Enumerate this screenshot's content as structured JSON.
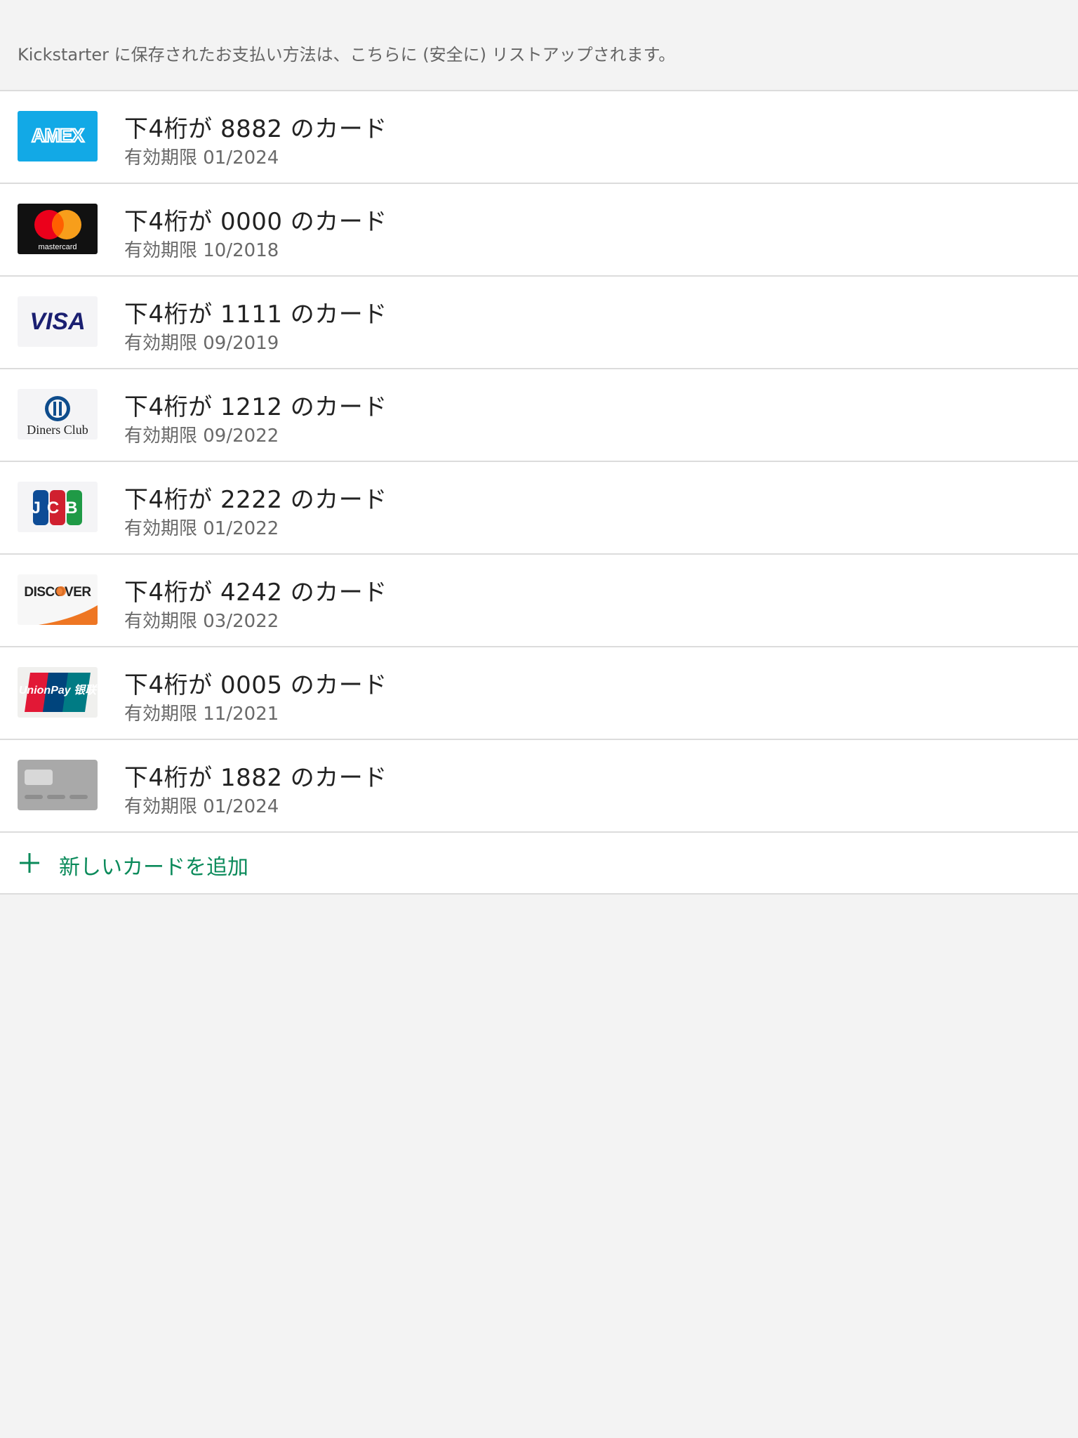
{
  "header": {
    "description": "Kickstarter に保存されたお支払い方法は、こちらに (安全に) リストアップされます。"
  },
  "cards": [
    {
      "brand": "amex-logo",
      "logo_text": "AMEX",
      "title": "下4桁が 8882 のカード",
      "expiry": "有効期限 01/2024"
    },
    {
      "brand": "mastercard-logo",
      "logo_text": "mastercard",
      "title": "下4桁が 0000 のカード",
      "expiry": "有効期限 10/2018"
    },
    {
      "brand": "visa-logo",
      "logo_text": "VISA",
      "title": "下4桁が 1111 のカード",
      "expiry": "有効期限 09/2019"
    },
    {
      "brand": "diners-club-logo",
      "logo_text": "Diners Club",
      "title": "下4桁が 1212 のカード",
      "expiry": "有効期限 09/2022"
    },
    {
      "brand": "jcb-logo",
      "logo_text": "JCB",
      "title": "下4桁が 2222 のカード",
      "expiry": "有効期限 01/2022"
    },
    {
      "brand": "discover-logo",
      "logo_text": "DISCOVER",
      "title": "下4桁が 4242 のカード",
      "expiry": "有効期限 03/2022"
    },
    {
      "brand": "unionpay-logo",
      "logo_text": "UnionPay 银联",
      "title": "下4桁が 0005 のカード",
      "expiry": "有効期限 11/2021"
    },
    {
      "brand": "generic-card-icon",
      "logo_text": "",
      "title": "下4桁が 1882 のカード",
      "expiry": "有効期限 01/2024"
    }
  ],
  "add_card": {
    "icon": "plus-icon",
    "label": "新しいカードを追加"
  },
  "colors": {
    "background": "#f3f3f3",
    "accent_green": "#0a8a5a",
    "amex_blue": "#12a9e6",
    "visa_navy": "#1a1f71"
  }
}
